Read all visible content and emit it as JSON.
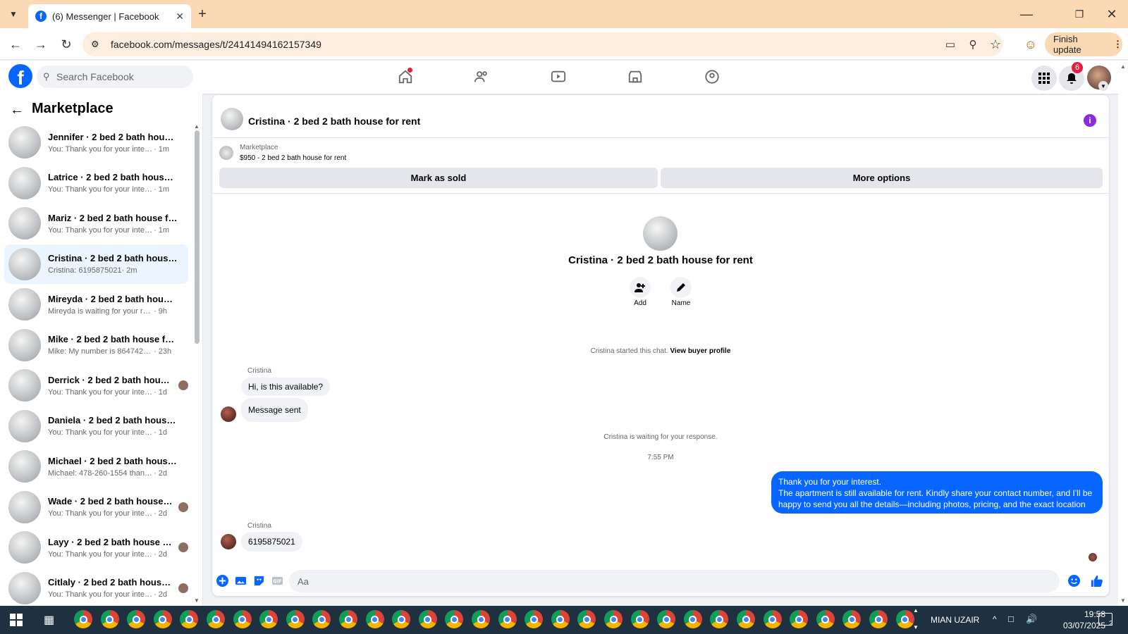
{
  "browser": {
    "tab_title": "(6) Messenger | Facebook",
    "url": "facebook.com/messages/t/24141494162157349",
    "finish_update": "Finish update"
  },
  "fb": {
    "search_placeholder": "Search Facebook",
    "notif_count": "6"
  },
  "sidebar": {
    "title": "Marketplace",
    "conversations": [
      {
        "name": "Jennifer · 2 bed 2 bath house fo...",
        "preview": "You: Thank you for your interest. T...",
        "time": "· 1m"
      },
      {
        "name": "Latrice · 2 bed 2 bath house for ...",
        "preview": "You: Thank you for your interest. T...",
        "time": "· 1m"
      },
      {
        "name": "Mariz · 2 bed 2 bath house for r...",
        "preview": "You: Thank you for your interest. T...",
        "time": "· 1m"
      },
      {
        "name": "Cristina · 2 bed 2 bath house fo...",
        "preview": "Cristina: 6195875021",
        "time": "· 2m"
      },
      {
        "name": "Mireyda · 2 bed 2 bath house fo...",
        "preview": "Mireyda is waiting for your respon...",
        "time": "· 9h"
      },
      {
        "name": "Mike · 2 bed 2 bath house for r...",
        "preview": "Mike: My number is 8647423137",
        "time": "· 23h"
      },
      {
        "name": "Derrick · 2 bed 2 bath house f...",
        "preview": "You: Thank you for your interest...",
        "time": "· 1d"
      },
      {
        "name": "Daniela · 2 bed 2 bath house fo...",
        "preview": "You: Thank you for your interest. T...",
        "time": "· 1d"
      },
      {
        "name": "Michael · 2 bed 2 bath house fo...",
        "preview": "Michael: 478-260-1554 thank you ...",
        "time": "· 2d"
      },
      {
        "name": "Wade · 2 bed 2 bath house fo...",
        "preview": "You: Thank you for your interest...",
        "time": "· 2d"
      },
      {
        "name": "Layy · 2 bed 2 bath house for...",
        "preview": "You: Thank you for your interest...",
        "time": "· 2d"
      },
      {
        "name": "Citlaly · 2 bed 2 bath house f...",
        "preview": "You: Thank you for your interest...",
        "time": "· 2d"
      }
    ]
  },
  "chat": {
    "title": "Cristina · 2 bed 2 bath house for rent",
    "marketplace_label": "Marketplace",
    "listing": "$950 - 2 bed 2 bath house for rent",
    "mark_sold": "Mark as sold",
    "more_options": "More options",
    "profile_name": "Cristina · 2 bed 2 bath house for rent",
    "add_label": "Add",
    "name_label": "Name",
    "started_text": "Cristina started this chat.",
    "view_profile": "View buyer profile",
    "sender": "Cristina",
    "msg1": "Hi, is this available?",
    "msg2": "Message sent",
    "waiting": "Cristina is waiting for your response.",
    "time": "7:55 PM",
    "out_line1": "Thank you for your interest.",
    "out_line2": "The apartment is still available for rent. Kindly share your contact number, and I'll be happy to send you all the details—including photos, pricing, and the exact location",
    "msg3": "6195875021",
    "input_placeholder": "Aa"
  },
  "taskbar": {
    "user": "MIAN UZAIR",
    "time": "19:58",
    "date": "03/07/2025",
    "notif": "2"
  }
}
